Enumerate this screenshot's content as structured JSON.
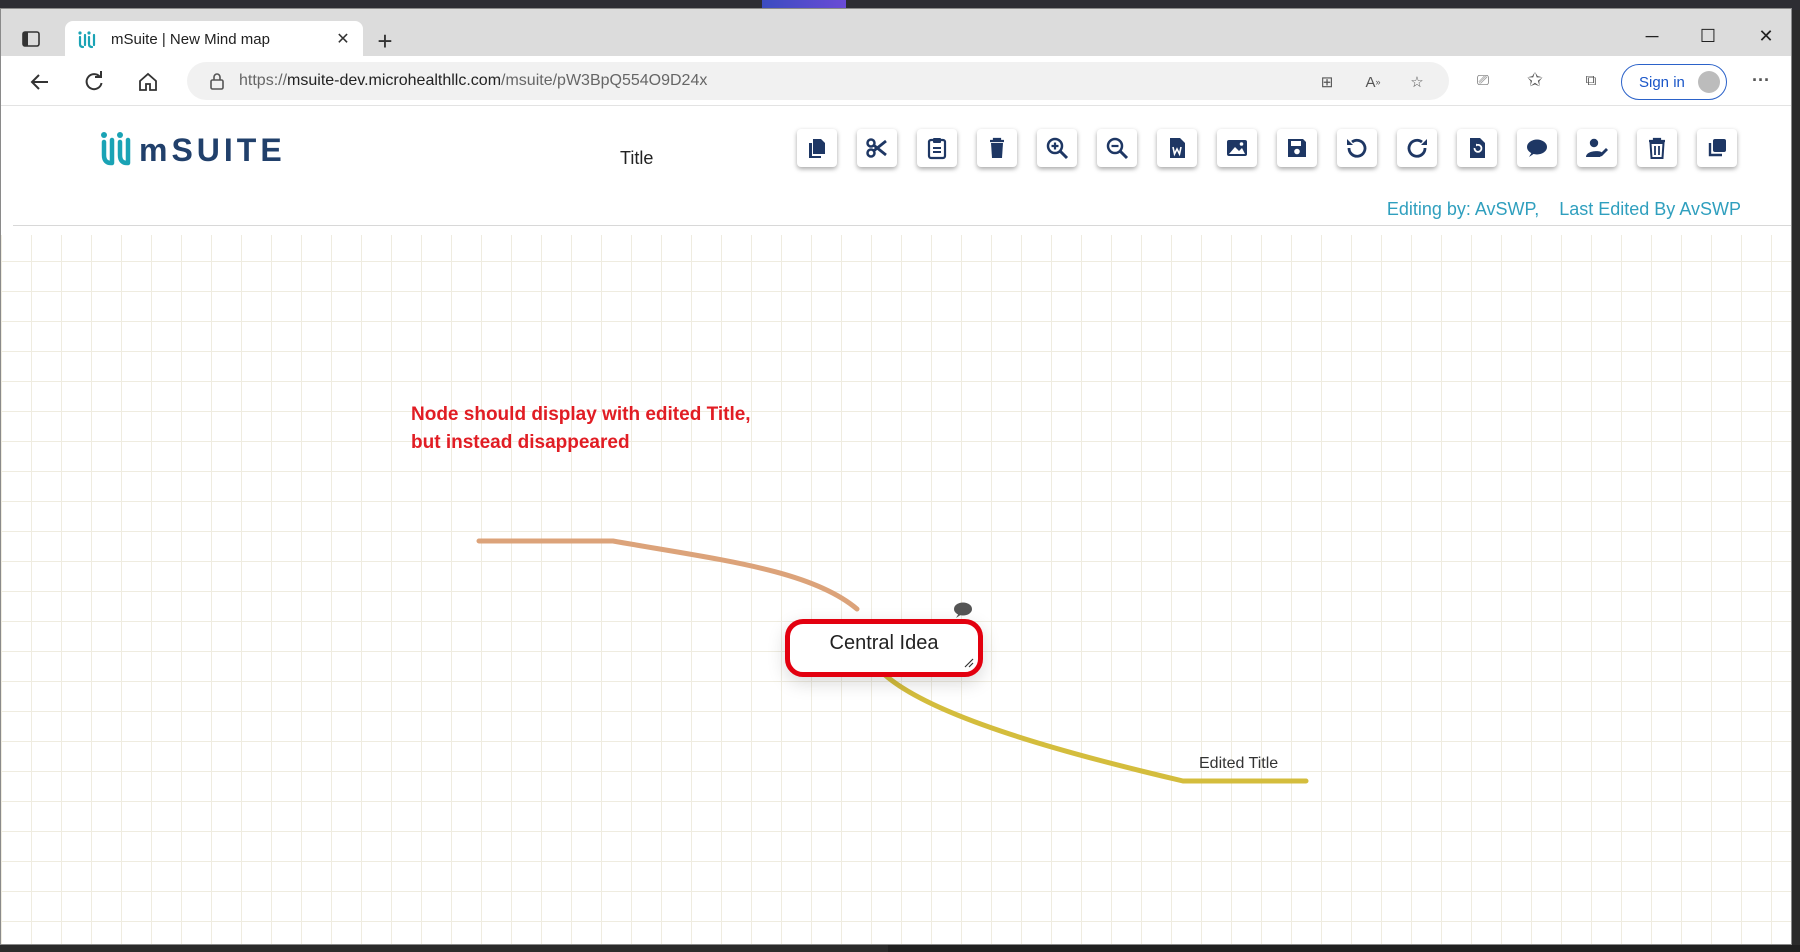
{
  "browser": {
    "tab_title": "mSuite | New Mind map",
    "url_prefix": "https://",
    "url_host": "msuite-dev.microhealthllc.com",
    "url_path": "/msuite/pW3BpQ554O9D24x",
    "signin_label": "Sign in"
  },
  "app": {
    "logo_text": "mSUITE",
    "doc_title": "Title",
    "editing_info": "Editing by: AvSWP,    Last Edited By AvSWP",
    "tools": [
      "copy-icon",
      "cut-icon",
      "paste-icon",
      "delete-icon",
      "zoom-in-icon",
      "zoom-out-icon",
      "export-word-icon",
      "image-icon",
      "save-icon",
      "undo-icon",
      "redo-icon",
      "restore-icon",
      "comment-icon",
      "user-edit-icon",
      "trash-icon",
      "duplicate-icon"
    ],
    "accent_color": "#2f9fbe",
    "tool_color": "#1e3764"
  },
  "mindmap": {
    "annotation_line1": "Node should display with edited Title,",
    "annotation_line2": "but instead disappeared",
    "central_node": "Central Idea",
    "child_node": "Edited Title",
    "branch_colors": {
      "left": "#dca37a",
      "right": "#d4bd3d"
    },
    "highlight_color": "#e3000f"
  }
}
